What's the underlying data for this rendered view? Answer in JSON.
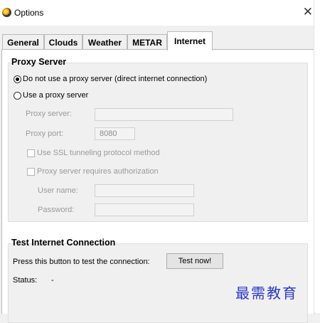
{
  "window": {
    "title": "Options",
    "close_symbol": "✕"
  },
  "tabs": [
    {
      "label": "General"
    },
    {
      "label": "Clouds"
    },
    {
      "label": "Weather"
    },
    {
      "label": "METAR"
    },
    {
      "label": "Internet",
      "active": true
    }
  ],
  "proxy": {
    "group_title": "Proxy Server",
    "option_direct": "Do not use a proxy server (direct internet connection)",
    "option_use": "Use a proxy server",
    "selected": "direct",
    "server_label": "Proxy server:",
    "server_value": "",
    "port_label": "Proxy port:",
    "port_value": "8080",
    "ssl_label": "Use SSL tunneling protocol method",
    "ssl_checked": false,
    "auth_label": "Proxy server requires authorization",
    "auth_checked": false,
    "user_label": "User name:",
    "user_value": "",
    "password_label": "Password:",
    "password_value": ""
  },
  "test": {
    "group_title": "Test Internet Connection",
    "prompt": "Press this button to test the connection:",
    "button_label": "Test now!",
    "status_label": "Status:",
    "status_value": "-"
  },
  "watermark": "最需教育"
}
